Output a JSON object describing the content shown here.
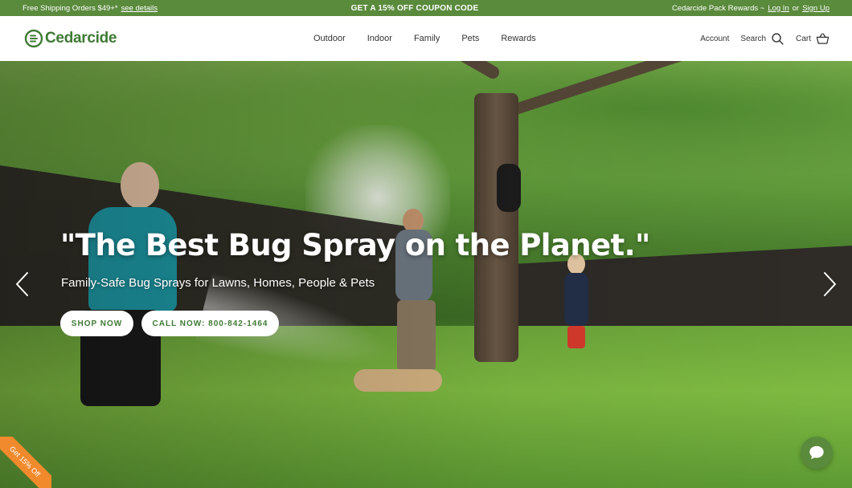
{
  "announcement": {
    "left_text": "Free Shipping Orders $49+*",
    "left_link": "see details",
    "center_text": "GET A 15% OFF COUPON CODE",
    "right_text": "Cedarcide Pack Rewards ~",
    "login_link": "Log In",
    "or_text": "or",
    "signup_link": "Sign Up",
    "bg_color": "#5a8a3c"
  },
  "header": {
    "logo_text": "Cedarcide",
    "nav": [
      "Outdoor",
      "Indoor",
      "Family",
      "Pets",
      "Rewards"
    ],
    "account_label": "Account",
    "search_label": "Search",
    "cart_label": "Cart"
  },
  "hero": {
    "title": "\"The Best Bug Spray on the Planet.\"",
    "subtitle": "Family-Safe Bug Sprays for Lawns, Homes, People & Pets",
    "shop_button": "SHOP NOW",
    "call_button": "CALL NOW: 800-842-1464",
    "prev_icon": "chevron-left-icon",
    "next_icon": "chevron-right-icon"
  },
  "ribbon": {
    "text": "Get 15% Off",
    "color": "#f08a2c"
  },
  "chat": {
    "icon": "chat-bubble-icon"
  }
}
